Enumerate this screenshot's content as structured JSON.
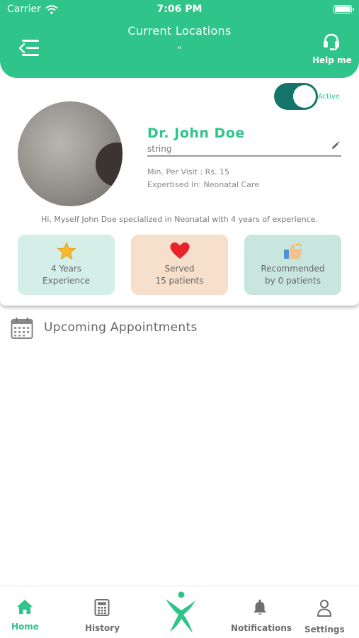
{
  "status_bar": {
    "carrier": "Carrier",
    "time": "7:06 PM"
  },
  "header": {
    "title": "Current Locations",
    "subtitle": "”",
    "help_label": "Help me"
  },
  "profile": {
    "status_label": "Active",
    "status_on": true,
    "name": "Dr. John Doe",
    "field_value": "string",
    "min_visit": "Min. Per Visit : Rs. 15",
    "expertise": "Expertised In: Neonatal Care",
    "bio": "Hi, Myself John Doe specialized in Neonatal with 4 years of experience."
  },
  "stats": [
    {
      "line1": "4 Years",
      "line2": "Experience",
      "icon": "star-icon",
      "bg": "#d3efe8"
    },
    {
      "line1": "Served",
      "line2": "15 patients",
      "icon": "heart-icon",
      "bg": "#f6dfcb"
    },
    {
      "line1": "Recommended",
      "line2": "by 0 patients",
      "icon": "thumbs-up-icon",
      "bg": "#c8e6de"
    }
  ],
  "appointments": {
    "title": "Upcoming  Appointments"
  },
  "nav": {
    "items": [
      {
        "label": "Home",
        "icon": "home-icon",
        "active": true
      },
      {
        "label": "History",
        "icon": "calculator-icon",
        "active": false
      },
      {
        "label": "Notifications",
        "icon": "bell-icon",
        "active": false
      },
      {
        "label": "Settings",
        "icon": "user-icon",
        "active": false
      }
    ]
  },
  "colors": {
    "primary": "#2ec48a",
    "toggle": "#15756b",
    "text": "#666666"
  }
}
